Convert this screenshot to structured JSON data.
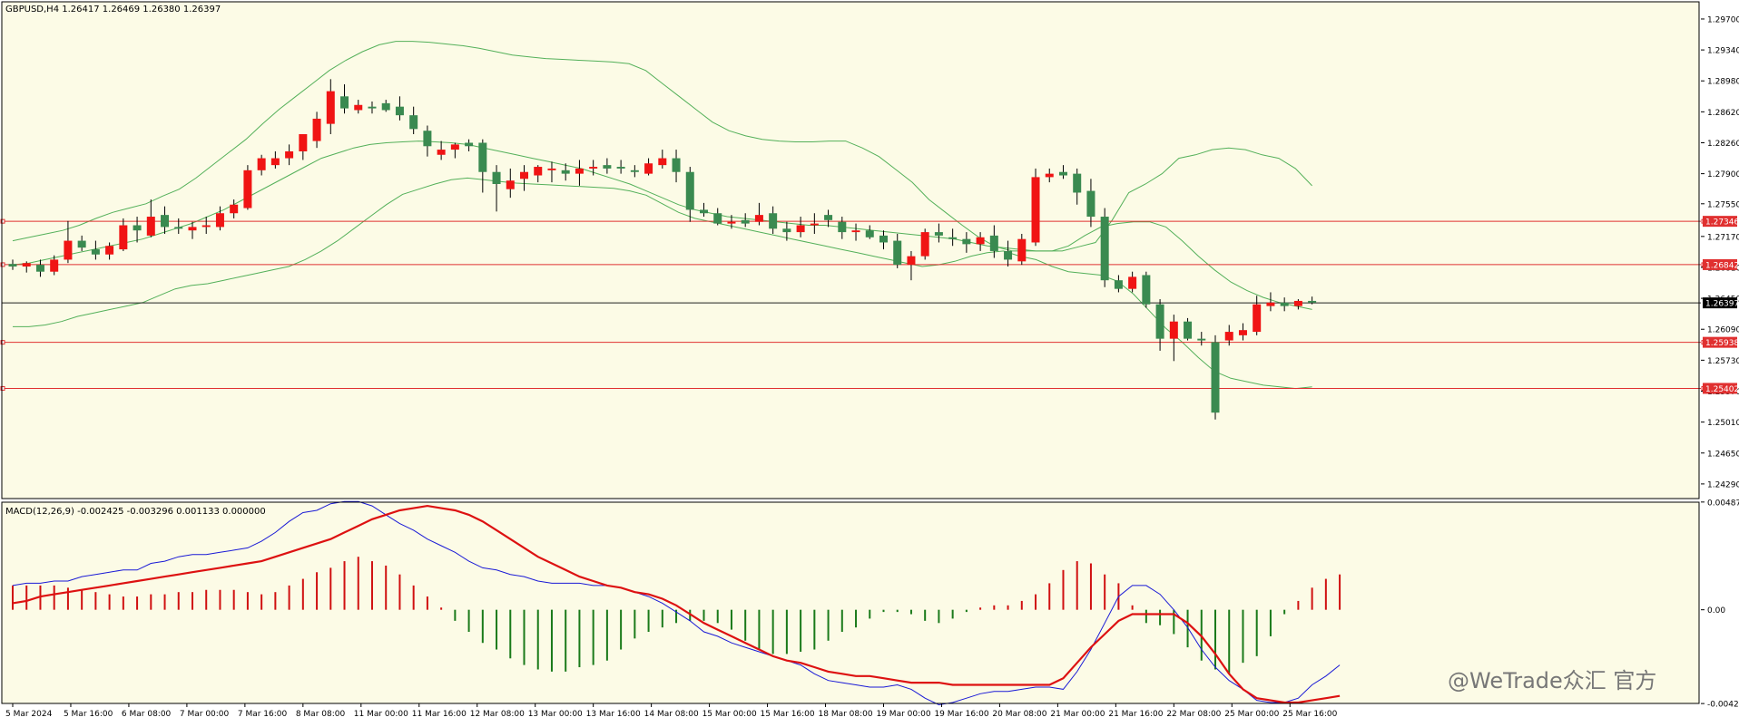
{
  "colors": {
    "background": "#fcfbe6",
    "frame": "#000000",
    "bull": "#3a8a50",
    "bear": "#f01414",
    "wick": "#000000",
    "bands": "#54b05a",
    "level_line": "#e03030",
    "price_line": "#202020",
    "macd_line": "#1a1ad6",
    "signal_line": "#dd1111",
    "hist_pos": "#d01010",
    "hist_neg": "#1a7a1a"
  },
  "chart_data": [
    {
      "type": "candlestick",
      "header": "GBPUSD,H4  1.26417 1.26469 1.26380 1.26397",
      "ylim": [
        1.2412,
        1.299
      ],
      "y_ticks": [
        "1.29700",
        "1.29340",
        "1.28980",
        "1.28620",
        "1.28260",
        "1.27900",
        "1.27550",
        "1.27170",
        "1.26810",
        "1.26450",
        "1.26090",
        "1.25730",
        "1.25370",
        "1.25010",
        "1.24650",
        "1.24290"
      ],
      "x_labels": [
        "5 Mar 2024",
        "5 Mar 16:00",
        "6 Mar 08:00",
        "7 Mar 00:00",
        "7 Mar 16:00",
        "8 Mar 08:00",
        "11 Mar 00:00",
        "11 Mar 16:00",
        "12 Mar 08:00",
        "13 Mar 00:00",
        "13 Mar 16:00",
        "14 Mar 08:00",
        "15 Mar 00:00",
        "15 Mar 16:00",
        "18 Mar 08:00",
        "19 Mar 00:00",
        "19 Mar 16:00",
        "20 Mar 08:00",
        "21 Mar 00:00",
        "21 Mar 16:00",
        "22 Mar 08:00",
        "25 Mar 00:00",
        "25 Mar 16:00"
      ],
      "levels": [
        "1.27346",
        "1.26842",
        "1.25938",
        "1.25402"
      ],
      "current_price": "1.26397",
      "candles": [
        [
          1.2685,
          1.269,
          1.2678,
          1.2682
        ],
        [
          1.2682,
          1.2688,
          1.2675,
          1.2686
        ],
        [
          1.2684,
          1.269,
          1.267,
          1.2676
        ],
        [
          1.2676,
          1.2695,
          1.2672,
          1.269
        ],
        [
          1.269,
          1.2735,
          1.2686,
          1.2712
        ],
        [
          1.2712,
          1.2718,
          1.27,
          1.2704
        ],
        [
          1.2702,
          1.2712,
          1.269,
          1.2696
        ],
        [
          1.2696,
          1.271,
          1.269,
          1.2706
        ],
        [
          1.2702,
          1.2738,
          1.27,
          1.273
        ],
        [
          1.273,
          1.274,
          1.271,
          1.2724
        ],
        [
          1.2718,
          1.276,
          1.2716,
          1.274
        ],
        [
          1.2742,
          1.2752,
          1.272,
          1.2728
        ],
        [
          1.2728,
          1.2738,
          1.272,
          1.2726
        ],
        [
          1.2724,
          1.2734,
          1.2714,
          1.2728
        ],
        [
          1.2728,
          1.274,
          1.272,
          1.273
        ],
        [
          1.2728,
          1.2752,
          1.2724,
          1.2744
        ],
        [
          1.2744,
          1.276,
          1.2738,
          1.2754
        ],
        [
          1.275,
          1.28,
          1.2748,
          1.2794
        ],
        [
          1.2794,
          1.2812,
          1.2788,
          1.2808
        ],
        [
          1.28,
          1.2816,
          1.2796,
          1.2808
        ],
        [
          1.2808,
          1.2824,
          1.28,
          1.2816
        ],
        [
          1.2816,
          1.2836,
          1.2806,
          1.2836
        ],
        [
          1.2828,
          1.2862,
          1.282,
          1.2854
        ],
        [
          1.2848,
          1.29,
          1.2836,
          1.2886
        ],
        [
          1.288,
          1.2894,
          1.286,
          1.2866
        ],
        [
          1.2864,
          1.2876,
          1.286,
          1.287
        ],
        [
          1.2868,
          1.2874,
          1.286,
          1.2866
        ],
        [
          1.2872,
          1.2876,
          1.2862,
          1.2864
        ],
        [
          1.2868,
          1.288,
          1.2852,
          1.2858
        ],
        [
          1.2858,
          1.2868,
          1.2836,
          1.2842
        ],
        [
          1.284,
          1.2846,
          1.281,
          1.2822
        ],
        [
          1.2812,
          1.2828,
          1.2806,
          1.2818
        ],
        [
          1.2818,
          1.2826,
          1.2808,
          1.2824
        ],
        [
          1.2826,
          1.283,
          1.2816,
          1.2822
        ],
        [
          1.2826,
          1.283,
          1.2768,
          1.2792
        ],
        [
          1.2792,
          1.28,
          1.2746,
          1.2778
        ],
        [
          1.2772,
          1.2796,
          1.2762,
          1.2782
        ],
        [
          1.2784,
          1.28,
          1.277,
          1.2792
        ],
        [
          1.2788,
          1.28,
          1.278,
          1.2798
        ],
        [
          1.2794,
          1.2804,
          1.278,
          1.2796
        ],
        [
          1.2794,
          1.2802,
          1.2782,
          1.279
        ],
        [
          1.279,
          1.2806,
          1.2776,
          1.2796
        ],
        [
          1.2796,
          1.2806,
          1.2788,
          1.2798
        ],
        [
          1.28,
          1.2808,
          1.279,
          1.2796
        ],
        [
          1.2798,
          1.2806,
          1.279,
          1.2796
        ],
        [
          1.2794,
          1.28,
          1.2786,
          1.2792
        ],
        [
          1.279,
          1.2808,
          1.2788,
          1.2802
        ],
        [
          1.28,
          1.2818,
          1.2796,
          1.2808
        ],
        [
          1.2808,
          1.2818,
          1.278,
          1.2792
        ],
        [
          1.2792,
          1.2798,
          1.2734,
          1.2748
        ],
        [
          1.2748,
          1.2756,
          1.274,
          1.2744
        ],
        [
          1.2744,
          1.275,
          1.273,
          1.2732
        ],
        [
          1.2732,
          1.2742,
          1.2726,
          1.2734
        ],
        [
          1.2736,
          1.2744,
          1.2728,
          1.2732
        ],
        [
          1.2734,
          1.2756,
          1.273,
          1.2742
        ],
        [
          1.2744,
          1.2752,
          1.272,
          1.2726
        ],
        [
          1.2726,
          1.2734,
          1.2712,
          1.2722
        ],
        [
          1.2722,
          1.274,
          1.2716,
          1.273
        ],
        [
          1.273,
          1.2744,
          1.272,
          1.2732
        ],
        [
          1.2742,
          1.2748,
          1.2728,
          1.2736
        ],
        [
          1.2734,
          1.274,
          1.2714,
          1.2722
        ],
        [
          1.2722,
          1.2732,
          1.2712,
          1.2724
        ],
        [
          1.2724,
          1.273,
          1.2714,
          1.2716
        ],
        [
          1.2718,
          1.2724,
          1.2702,
          1.271
        ],
        [
          1.2712,
          1.272,
          1.268,
          1.2684
        ],
        [
          1.2684,
          1.27,
          1.2666,
          1.2694
        ],
        [
          1.2694,
          1.2726,
          1.269,
          1.2722
        ],
        [
          1.2722,
          1.2732,
          1.271,
          1.2718
        ],
        [
          1.2716,
          1.2726,
          1.2706,
          1.2714
        ],
        [
          1.2714,
          1.2722,
          1.2698,
          1.2708
        ],
        [
          1.2708,
          1.2722,
          1.27,
          1.2716
        ],
        [
          1.2718,
          1.273,
          1.2692,
          1.27
        ],
        [
          1.27,
          1.2712,
          1.2682,
          1.269
        ],
        [
          1.2688,
          1.272,
          1.2684,
          1.2714
        ],
        [
          1.271,
          1.2796,
          1.2706,
          1.2786
        ],
        [
          1.2786,
          1.2796,
          1.278,
          1.279
        ],
        [
          1.2792,
          1.28,
          1.2784,
          1.2788
        ],
        [
          1.279,
          1.2796,
          1.2754,
          1.2768
        ],
        [
          1.277,
          1.2784,
          1.2728,
          1.274
        ],
        [
          1.274,
          1.275,
          1.2658,
          1.2666
        ],
        [
          1.2666,
          1.2672,
          1.2652,
          1.2656
        ],
        [
          1.2656,
          1.2676,
          1.2652,
          1.267
        ],
        [
          1.2672,
          1.2676,
          1.2634,
          1.2638
        ],
        [
          1.2638,
          1.2644,
          1.2584,
          1.2598
        ],
        [
          1.2598,
          1.2626,
          1.2572,
          1.2618
        ],
        [
          1.2618,
          1.2622,
          1.2596,
          1.2598
        ],
        [
          1.2598,
          1.2606,
          1.259,
          1.2596
        ],
        [
          1.2594,
          1.2602,
          1.2504,
          1.2512
        ],
        [
          1.2596,
          1.2614,
          1.259,
          1.2606
        ],
        [
          1.2602,
          1.2616,
          1.2596,
          1.2608
        ],
        [
          1.2606,
          1.2648,
          1.2602,
          1.2638
        ],
        [
          1.2636,
          1.2652,
          1.263,
          1.264
        ],
        [
          1.264,
          1.2646,
          1.263,
          1.2636
        ],
        [
          1.2636,
          1.2644,
          1.2632,
          1.2642
        ],
        [
          1.2642,
          1.2647,
          1.2638,
          1.264
        ]
      ],
      "bands_upper": [
        1.2712,
        1.2716,
        1.272,
        1.2724,
        1.273,
        1.2738,
        1.2745,
        1.275,
        1.2755,
        1.2764,
        1.2772,
        1.2785,
        1.28,
        1.2815,
        1.283,
        1.2848,
        1.2865,
        1.288,
        1.2895,
        1.291,
        1.2922,
        1.2932,
        1.294,
        1.2944,
        1.2944,
        1.2943,
        1.2941,
        1.2939,
        1.2936,
        1.2932,
        1.2928,
        1.2926,
        1.2924,
        1.2923,
        1.2922,
        1.2921,
        1.292,
        1.2918,
        1.291,
        1.2895,
        1.288,
        1.2865,
        1.285,
        1.284,
        1.2834,
        1.283,
        1.2828,
        1.2827,
        1.2827,
        1.2828,
        1.2828,
        1.282,
        1.281,
        1.2795,
        1.278,
        1.276,
        1.2745,
        1.273,
        1.2716,
        1.2705,
        1.27,
        1.27,
        1.27,
        1.27,
        1.2705,
        1.271,
        1.2736,
        1.2768,
        1.2778,
        1.279,
        1.2808,
        1.2812,
        1.2818,
        1.282,
        1.2818,
        1.2812,
        1.2808,
        1.2796,
        1.2776
      ],
      "bands_mid": [
        1.2684,
        1.2686,
        1.269,
        1.2694,
        1.2698,
        1.2702,
        1.2706,
        1.271,
        1.2714,
        1.272,
        1.2726,
        1.2732,
        1.274,
        1.2748,
        1.2758,
        1.2768,
        1.2778,
        1.2788,
        1.2798,
        1.2808,
        1.2814,
        1.282,
        1.2824,
        1.2826,
        1.2827,
        1.2828,
        1.2827,
        1.2826,
        1.2824,
        1.282,
        1.2816,
        1.2812,
        1.2808,
        1.2804,
        1.28,
        1.2796,
        1.279,
        1.2784,
        1.2778,
        1.277,
        1.2762,
        1.2754,
        1.2748,
        1.2744,
        1.274,
        1.2738,
        1.2736,
        1.2734,
        1.2732,
        1.273,
        1.273,
        1.2728,
        1.2726,
        1.2724,
        1.2722,
        1.272,
        1.2718,
        1.2716,
        1.2714,
        1.271,
        1.2706,
        1.2704,
        1.2702,
        1.27,
        1.27,
        1.2706,
        1.2718,
        1.2728,
        1.2732,
        1.2734,
        1.2734,
        1.2728,
        1.2712,
        1.2694,
        1.2678,
        1.2664,
        1.2654,
        1.2646,
        1.264,
        1.2636,
        1.2632
      ],
      "bands_lower": [
        1.2612,
        1.2612,
        1.2614,
        1.2618,
        1.2624,
        1.2628,
        1.2632,
        1.2636,
        1.264,
        1.2648,
        1.2656,
        1.266,
        1.2662,
        1.2666,
        1.267,
        1.2674,
        1.2678,
        1.2682,
        1.269,
        1.27,
        1.2712,
        1.2726,
        1.274,
        1.2754,
        1.2766,
        1.2772,
        1.2778,
        1.2783,
        1.2785,
        1.2783,
        1.2781,
        1.2779,
        1.2778,
        1.2777,
        1.2776,
        1.2775,
        1.2774,
        1.2773,
        1.277,
        1.2765,
        1.2755,
        1.2745,
        1.2738,
        1.2734,
        1.273,
        1.2726,
        1.2722,
        1.2718,
        1.2714,
        1.271,
        1.2706,
        1.2702,
        1.2698,
        1.2694,
        1.269,
        1.2686,
        1.2682,
        1.2684,
        1.2688,
        1.2694,
        1.2698,
        1.27,
        1.2694,
        1.269,
        1.2682,
        1.2676,
        1.2674,
        1.2672,
        1.2665,
        1.265,
        1.263,
        1.261,
        1.2594,
        1.2576,
        1.256,
        1.2552,
        1.2548,
        1.2544,
        1.2542,
        1.254,
        1.2542
      ]
    },
    {
      "type": "macd",
      "header": "MACD(12,26,9) -0.002425 -0.003296 0.001133 0.000000",
      "ylim": [
        -0.00424,
        0.00487
      ],
      "y_ticks": [
        "0.004877",
        "0.00",
        "-0.004245"
      ],
      "histogram": [
        0.0011,
        0.0011,
        0.0011,
        0.0011,
        0.001,
        0.0009,
        0.0008,
        0.0007,
        0.0006,
        0.0006,
        0.0007,
        0.0007,
        0.0008,
        0.0008,
        0.0009,
        0.0009,
        0.0009,
        0.0008,
        0.0007,
        0.0008,
        0.0011,
        0.0014,
        0.0017,
        0.0019,
        0.0022,
        0.0024,
        0.0022,
        0.002,
        0.0016,
        0.0011,
        0.0006,
        0.0001,
        -0.0005,
        -0.001,
        -0.0015,
        -0.0018,
        -0.0022,
        -0.0025,
        -0.0027,
        -0.0028,
        -0.0028,
        -0.0026,
        -0.0025,
        -0.0023,
        -0.0018,
        -0.0013,
        -0.001,
        -0.0008,
        -0.0006,
        -0.0005,
        -0.0005,
        -0.0006,
        -0.0009,
        -0.0014,
        -0.0018,
        -0.002,
        -0.002,
        -0.0019,
        -0.0018,
        -0.0014,
        -0.001,
        -0.0008,
        -0.0004,
        -0.0001,
        -0.0001,
        -0.0002,
        -0.0005,
        -0.0006,
        -0.0004,
        -0.0001,
        0.0001,
        0.0002,
        0.0002,
        0.0004,
        0.0007,
        0.0012,
        0.0018,
        0.0022,
        0.0021,
        0.0016,
        0.0012,
        0.0002,
        -0.0006,
        -0.0007,
        -0.0011,
        -0.0017,
        -0.0023,
        -0.0027,
        -0.0029,
        -0.0024,
        -0.0021,
        -0.0012,
        -0.0002,
        0.0004,
        0.001,
        0.0014,
        0.0016
      ],
      "macd_line": [
        0.0011,
        0.0012,
        0.0012,
        0.0013,
        0.0013,
        0.0015,
        0.0016,
        0.0017,
        0.0018,
        0.0018,
        0.0021,
        0.0022,
        0.0024,
        0.0025,
        0.0025,
        0.0026,
        0.0027,
        0.0028,
        0.0031,
        0.0035,
        0.004,
        0.0044,
        0.0045,
        0.0048,
        0.0049,
        0.0049,
        0.0047,
        0.0043,
        0.0039,
        0.0036,
        0.0032,
        0.0029,
        0.0026,
        0.0022,
        0.0019,
        0.0018,
        0.0016,
        0.0015,
        0.0013,
        0.0012,
        0.0012,
        0.0012,
        0.0011,
        0.0011,
        0.001,
        0.0008,
        0.0006,
        0.0003,
        -0.0001,
        -0.0005,
        -0.001,
        -0.0012,
        -0.0015,
        -0.0017,
        -0.0019,
        -0.0021,
        -0.0023,
        -0.0025,
        -0.0029,
        -0.0032,
        -0.0033,
        -0.0034,
        -0.0035,
        -0.0035,
        -0.0034,
        -0.0036,
        -0.004,
        -0.0043,
        -0.0042,
        -0.004,
        -0.0038,
        -0.0037,
        -0.0037,
        -0.0036,
        -0.0035,
        -0.0035,
        -0.0036,
        -0.0028,
        -0.0018,
        -0.0006,
        0.0006,
        0.0011,
        0.0011,
        0.0007,
        0.0,
        -0.0008,
        -0.0018,
        -0.0026,
        -0.0032,
        -0.0036,
        -0.0041,
        -0.0042,
        -0.0042,
        -0.004,
        -0.0034,
        -0.003,
        -0.0025
      ],
      "signal_line": [
        0.0003,
        0.0004,
        0.0006,
        0.0007,
        0.0008,
        0.0009,
        0.001,
        0.0011,
        0.0012,
        0.0013,
        0.0014,
        0.0015,
        0.0016,
        0.0017,
        0.0018,
        0.0019,
        0.002,
        0.0021,
        0.0022,
        0.0024,
        0.0026,
        0.0028,
        0.003,
        0.0032,
        0.0035,
        0.0038,
        0.0041,
        0.0043,
        0.0045,
        0.0046,
        0.0047,
        0.0046,
        0.0045,
        0.0043,
        0.004,
        0.0036,
        0.0032,
        0.0028,
        0.0024,
        0.0021,
        0.0018,
        0.0015,
        0.0013,
        0.0011,
        0.001,
        0.0008,
        0.0007,
        0.0005,
        0.0002,
        -0.0002,
        -0.0006,
        -0.0009,
        -0.0012,
        -0.0015,
        -0.0018,
        -0.0021,
        -0.0023,
        -0.0024,
        -0.0026,
        -0.0028,
        -0.0029,
        -0.003,
        -0.003,
        -0.0031,
        -0.0032,
        -0.0033,
        -0.0033,
        -0.0033,
        -0.0034,
        -0.0034,
        -0.0034,
        -0.0034,
        -0.0034,
        -0.0034,
        -0.0034,
        -0.0034,
        -0.0031,
        -0.0024,
        -0.0017,
        -0.0011,
        -0.0005,
        -0.0002,
        -0.0002,
        -0.0002,
        -0.0002,
        -0.0006,
        -0.0012,
        -0.002,
        -0.0029,
        -0.0036,
        -0.004,
        -0.0041,
        -0.0042,
        -0.0042,
        -0.0041,
        -0.004,
        -0.0039
      ]
    }
  ],
  "watermark": "@WeTrade众汇 官方"
}
